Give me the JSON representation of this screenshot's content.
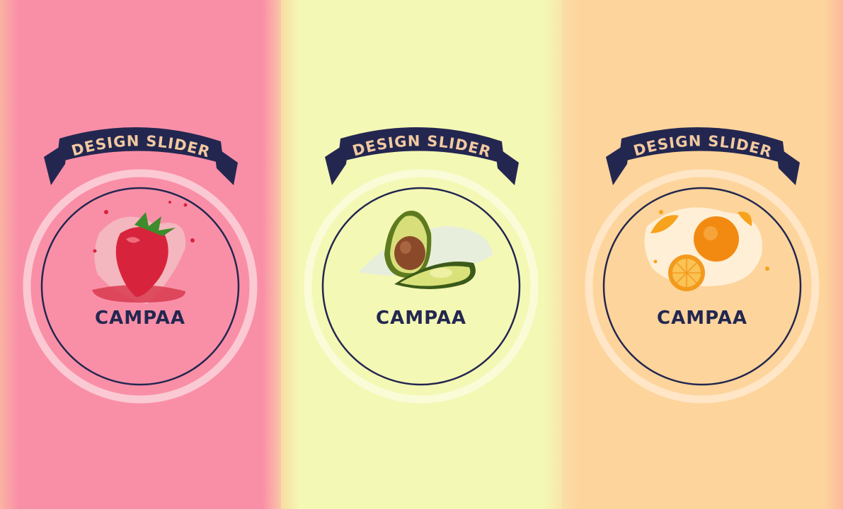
{
  "colors": {
    "navy": "#232750",
    "ribbon_text": "#F2C9A0",
    "panel_bg": [
      "#F98FA7",
      "#F4F8B5",
      "#FDD49B"
    ],
    "ring": [
      "#FBC9D3",
      "#FAFCD8",
      "#FEE6C6"
    ]
  },
  "panels": [
    {
      "ribbon": "DESIGN SLIDER",
      "brand": "CAMPAA",
      "fruit": "strawberry-icon"
    },
    {
      "ribbon": "DESIGN SLIDER",
      "brand": "CAMPAA",
      "fruit": "avocado-icon"
    },
    {
      "ribbon": "DESIGN SLIDER",
      "brand": "CAMPAA",
      "fruit": "orange-icon"
    }
  ]
}
